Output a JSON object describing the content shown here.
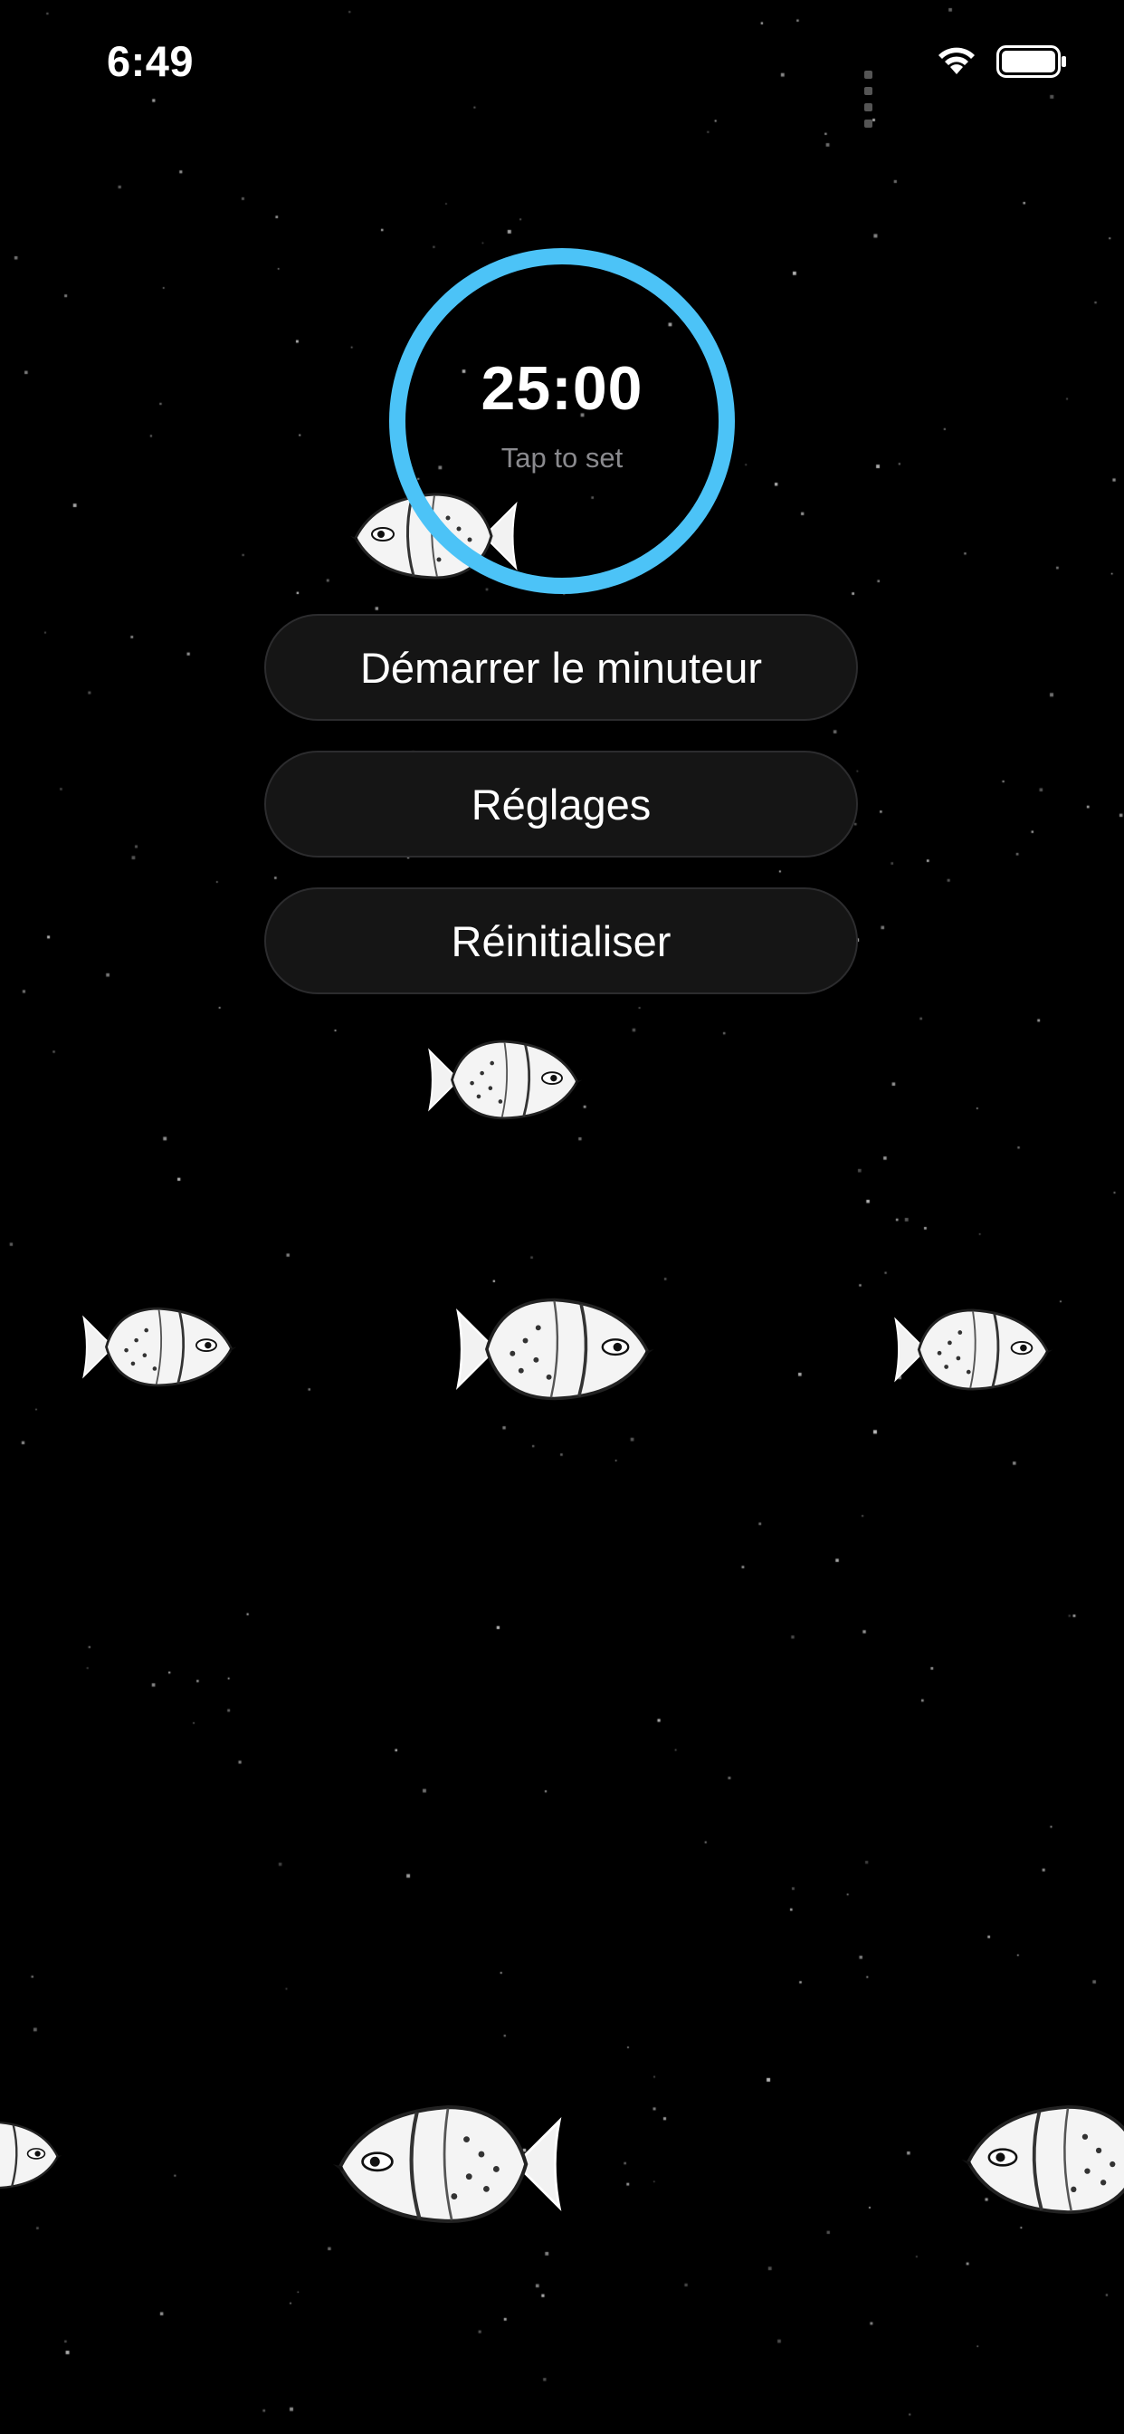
{
  "status_bar": {
    "time": "6:49"
  },
  "timer": {
    "value": "25:00",
    "hint": "Tap to set",
    "ring_color": "#4cc3f7"
  },
  "actions": {
    "start_label": "Démarrer le minuteur",
    "settings_label": "Réglages",
    "reset_label": "Réinitialiser"
  }
}
